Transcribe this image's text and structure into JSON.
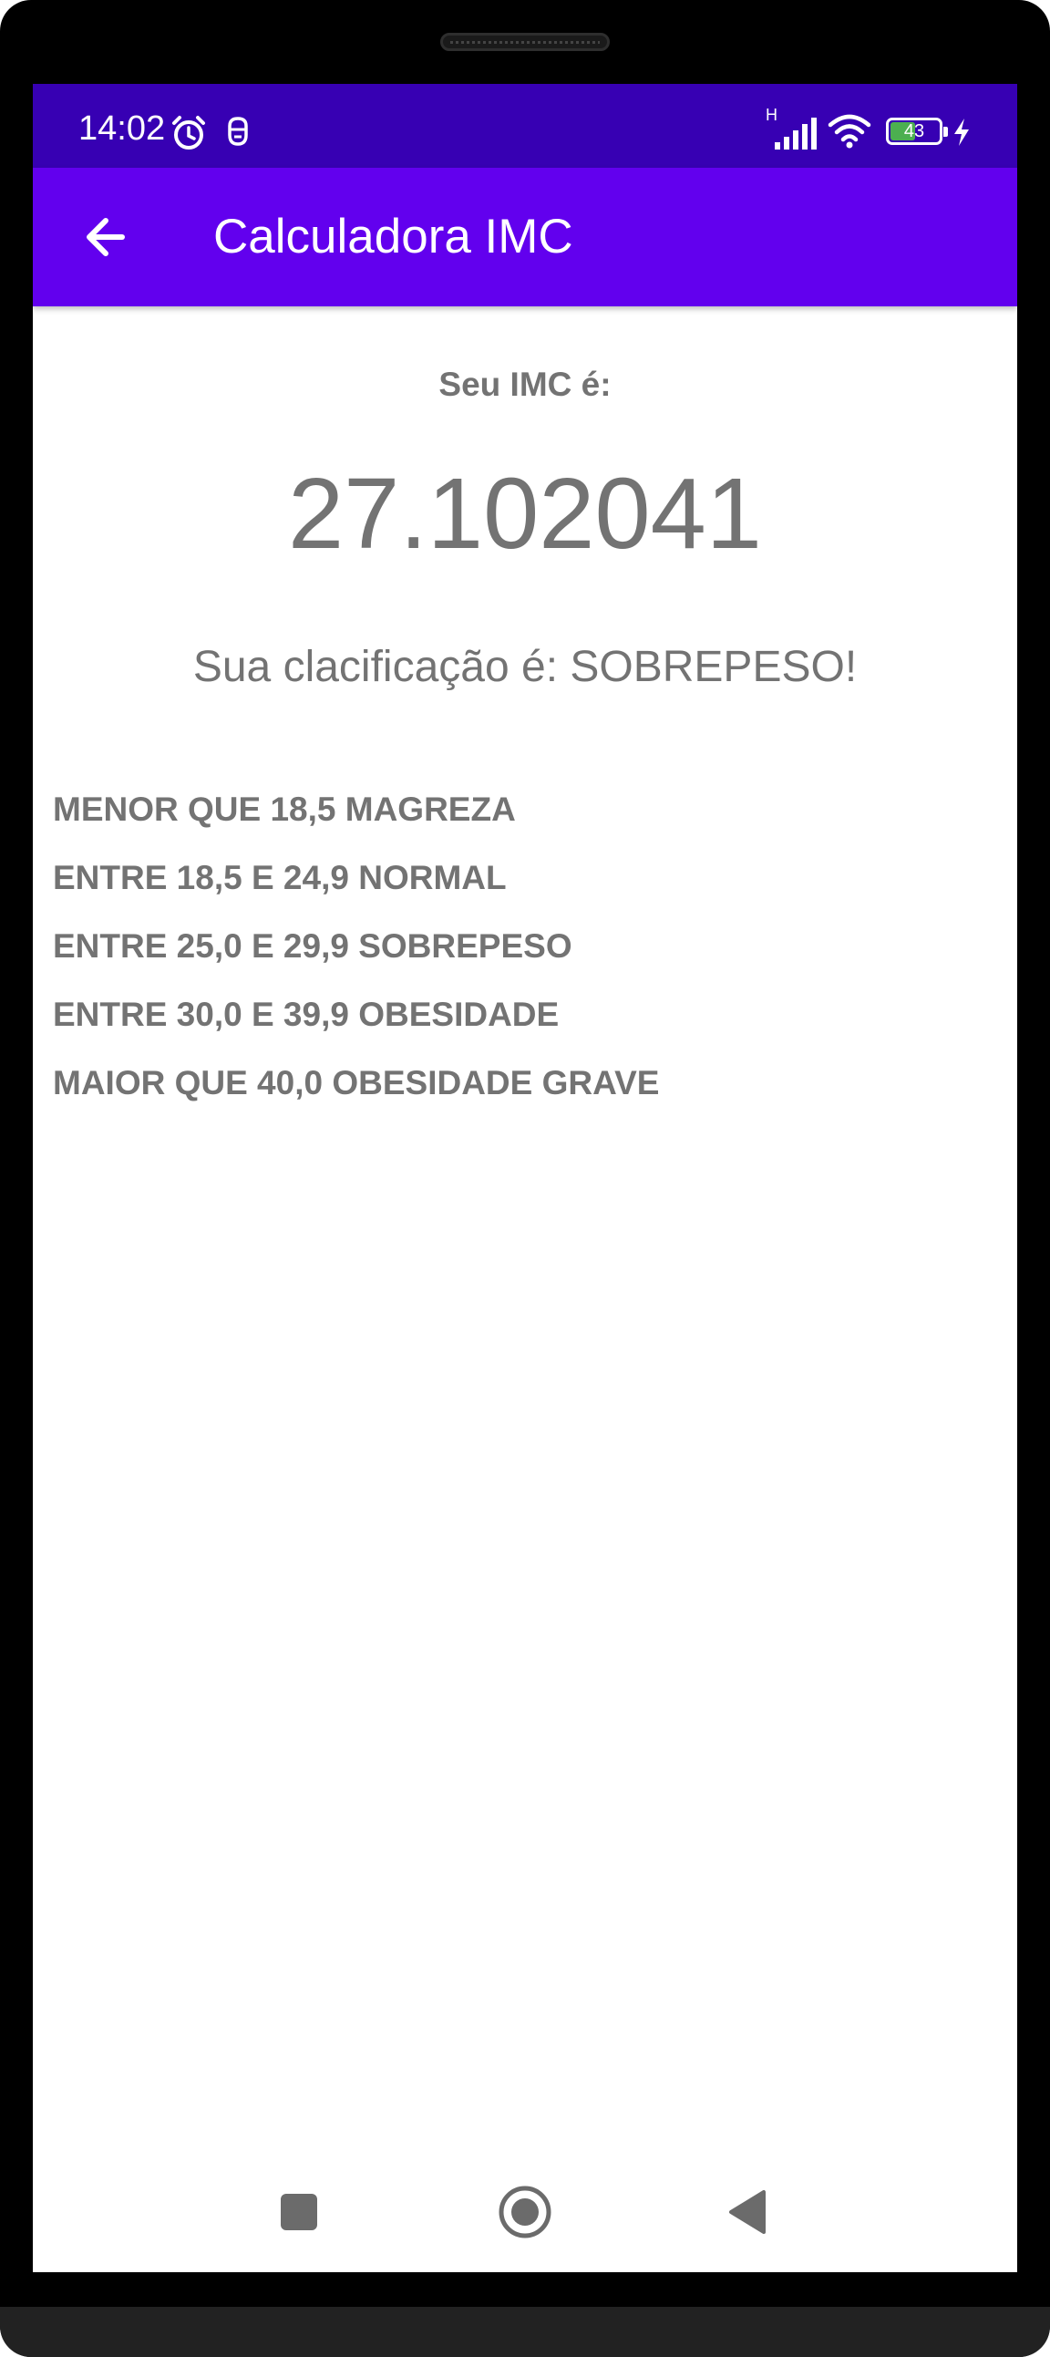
{
  "status_bar": {
    "time": "14:02",
    "network_label": "H",
    "battery_level": "43",
    "icons": [
      "alarm-icon",
      "notification-icon",
      "signal-icon",
      "wifi-icon",
      "battery-icon",
      "charging-icon"
    ]
  },
  "app_bar": {
    "title": "Calculadora IMC",
    "back_icon": "arrow-back-icon"
  },
  "result": {
    "label": "Seu IMC é:",
    "value": "27.102041",
    "classification": "Sua clacificação é: SOBREPESO!"
  },
  "ranges": [
    "MENOR QUE 18,5 MAGREZA",
    "ENTRE 18,5 E 24,9 NORMAL",
    "ENTRE 25,0 E 29,9 SOBREPESO",
    "ENTRE 30,0 E 39,9 OBESIDADE",
    "MAIOR QUE 40,0 OBESIDADE GRAVE"
  ],
  "nav_bar": {
    "buttons": [
      "recents-icon",
      "home-icon",
      "back-triangle-icon"
    ]
  },
  "colors": {
    "status_bar": "#3700b3",
    "app_bar": "#6200ee",
    "text": "#737373",
    "nav_icons": "#6b6b6b",
    "battery_fill": "#4caf50"
  }
}
